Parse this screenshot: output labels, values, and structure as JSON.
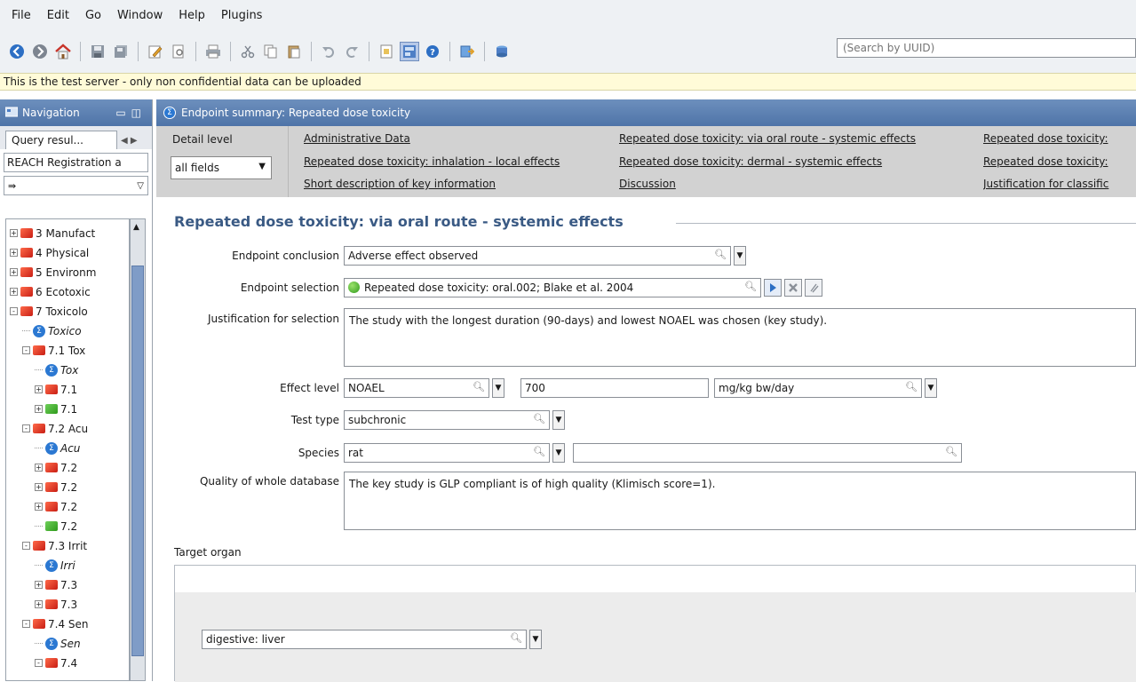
{
  "menu": {
    "items": [
      {
        "label": "File",
        "accel": "F"
      },
      {
        "label": "Edit",
        "accel": "E"
      },
      {
        "label": "Go",
        "accel": "G"
      },
      {
        "label": "Window",
        "accel": "W"
      },
      {
        "label": "Help",
        "accel": "H"
      },
      {
        "label": "Plugins",
        "accel": ""
      }
    ]
  },
  "toolbar": {
    "search_placeholder": "(Search by UUID)"
  },
  "banner": {
    "text": "This is the test server - only non confidential data can be uploaded"
  },
  "nav": {
    "title": "Navigation",
    "tab_label": "Query resul...",
    "field_value": "REACH Registration a",
    "tree": [
      {
        "label": "3 Manufact",
        "level": 0,
        "icon": "book-red",
        "expander": "+",
        "italic": false
      },
      {
        "label": "4 Physical",
        "level": 0,
        "icon": "book-red",
        "expander": "+",
        "italic": false
      },
      {
        "label": "5 Environm",
        "level": 0,
        "icon": "book-red",
        "expander": "+",
        "italic": false
      },
      {
        "label": "6 Ecotoxic",
        "level": 0,
        "icon": "book-red",
        "expander": "+",
        "italic": false
      },
      {
        "label": "7 Toxicolo",
        "level": 0,
        "icon": "book-red",
        "expander": "-",
        "italic": false
      },
      {
        "label": "Toxico",
        "level": 1,
        "icon": "summary",
        "expander": "",
        "italic": true
      },
      {
        "label": "7.1 Tox",
        "level": 1,
        "icon": "book-red",
        "expander": "-",
        "italic": false
      },
      {
        "label": "Tox",
        "level": 2,
        "icon": "summary",
        "expander": "",
        "italic": true
      },
      {
        "label": "7.1",
        "level": 2,
        "icon": "book-red",
        "expander": "+",
        "italic": false
      },
      {
        "label": "7.1",
        "level": 2,
        "icon": "book-green",
        "expander": "+",
        "italic": false
      },
      {
        "label": "7.2 Acu",
        "level": 1,
        "icon": "book-red",
        "expander": "-",
        "italic": false
      },
      {
        "label": "Acu",
        "level": 2,
        "icon": "summary",
        "expander": "",
        "italic": true
      },
      {
        "label": "7.2",
        "level": 2,
        "icon": "book-red",
        "expander": "+",
        "italic": false
      },
      {
        "label": "7.2",
        "level": 2,
        "icon": "book-red",
        "expander": "+",
        "italic": false
      },
      {
        "label": "7.2",
        "level": 2,
        "icon": "book-red",
        "expander": "+",
        "italic": false
      },
      {
        "label": "7.2",
        "level": 2,
        "icon": "book-green",
        "expander": "",
        "italic": false
      },
      {
        "label": "7.3 Irrit",
        "level": 1,
        "icon": "book-red",
        "expander": "-",
        "italic": false
      },
      {
        "label": "Irri",
        "level": 2,
        "icon": "summary",
        "expander": "",
        "italic": true
      },
      {
        "label": "7.3",
        "level": 2,
        "icon": "book-red",
        "expander": "+",
        "italic": false
      },
      {
        "label": "7.3",
        "level": 2,
        "icon": "book-red",
        "expander": "+",
        "italic": false
      },
      {
        "label": "7.4 Sen",
        "level": 1,
        "icon": "book-red",
        "expander": "-",
        "italic": false
      },
      {
        "label": "Sen",
        "level": 2,
        "icon": "summary",
        "expander": "",
        "italic": true
      },
      {
        "label": "7.4",
        "level": 2,
        "icon": "book-red",
        "expander": "-",
        "italic": false
      }
    ]
  },
  "main": {
    "title": "Endpoint summary: Repeated dose toxicity",
    "detail_label": "Detail level",
    "detail_value": "all fields",
    "links": {
      "l1": "Administrative Data",
      "l2": "Repeated dose toxicity: inhalation - local effects",
      "l3": "Short description of key information",
      "l4": "Repeated dose toxicity: via oral route - systemic effects",
      "l5": "Repeated dose toxicity: dermal - systemic effects",
      "l6": "Discussion",
      "l7": "Repeated dose toxicity: ",
      "l8": "Repeated dose toxicity: ",
      "l9": "Justification for classific"
    },
    "section_title": "Repeated dose toxicity: via oral route - systemic effects",
    "fields": {
      "conclusion_label": "Endpoint conclusion",
      "conclusion_value": "Adverse effect observed",
      "selection_label": "Endpoint selection",
      "selection_value": "Repeated dose toxicity: oral.002; Blake et al. 2004",
      "justification_label": "Justification for selection",
      "justification_value": "The study with the longest duration (90-days) and lowest NOAEL was chosen (key study).",
      "effect_label": "Effect level",
      "effect_type": "NOAEL",
      "effect_value": "700",
      "effect_unit": "mg/kg bw/day",
      "test_type_label": "Test type",
      "test_type_value": "subchronic",
      "species_label": "Species",
      "species_value": "rat",
      "species_extra": "",
      "quality_label": "Quality of whole database",
      "quality_value": "The key study is GLP compliant is of high quality (Klimisch score=1).",
      "target_organ_label": "Target organ",
      "target_organ_value": "digestive: liver"
    }
  },
  "colors": {
    "panel_header": "#5a7fb2",
    "section_title": "#3a5a84",
    "banner": "#fffbd8",
    "detail_bar": "#d2d2d2"
  }
}
